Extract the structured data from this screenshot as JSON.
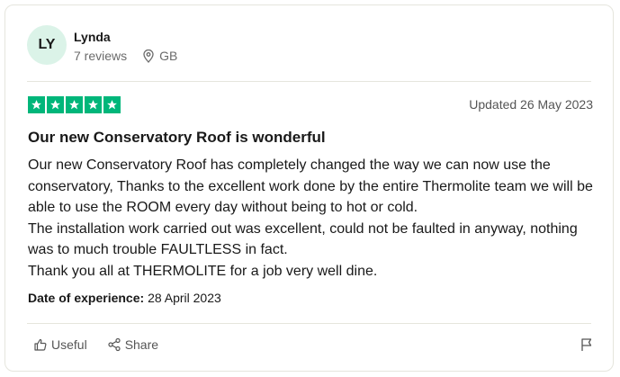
{
  "reviewer": {
    "initials": "LY",
    "name": "Lynda",
    "reviews_count": "7 reviews",
    "country": "GB"
  },
  "rating": {
    "stars": 5,
    "max": 5,
    "color": "#00b67a"
  },
  "updated": "Updated 26 May 2023",
  "review": {
    "title": "Our new Conservatory Roof is wonderful",
    "paragraphs": [
      "Our new Conservatory Roof has completely changed the way we can now use the conservatory, Thanks to the excellent work done by the entire Thermolite team we will be able to use the ROOM every day without being to hot or cold.",
      "The installation work carried out was excellent, could not be faulted in anyway, nothing was to much trouble FAULTLESS in fact.",
      "Thank you all at THERMOLITE for a job very well dine."
    ]
  },
  "experience": {
    "label": "Date of experience:",
    "value": "28 April 2023"
  },
  "actions": {
    "useful_label": "Useful",
    "share_label": "Share",
    "useful_icon": "thumbs-up-icon",
    "share_icon": "share-icon",
    "report_icon": "flag-icon"
  }
}
